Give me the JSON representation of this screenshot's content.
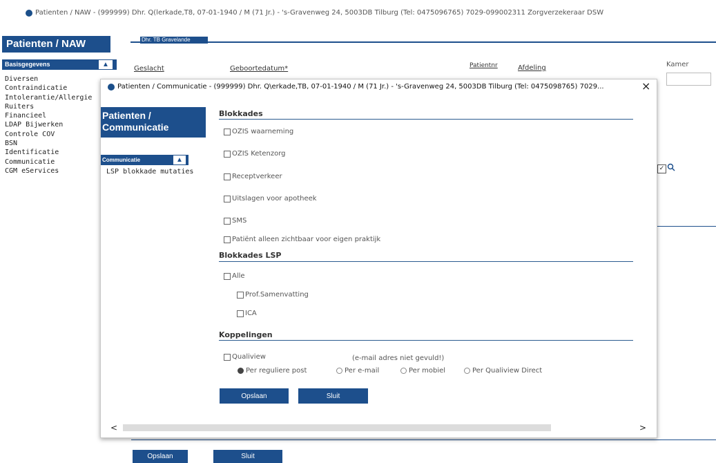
{
  "window": {
    "title": "Patienten / NAW - (999999) Dhr. Q(lerkade,T8, 07-01-1940 / M (71 Jr.) - 's-Gravenweg 24, 5003DB Tilburg (Tel: 0475096765) 7029-099002311 Zorgverzekeraar DSW"
  },
  "background": {
    "heading": "Patienten / NAW",
    "tab": "Dhr. TB Gravelande",
    "sidebar_section": "Basisgegevens",
    "sidebar_items": [
      "Diversen",
      "Contraindicatie",
      "Intolerantie/Allergie",
      "Ruiters",
      "Financieel",
      "LDAP Bijwerken",
      "Controle COV",
      "BSN",
      "Identificatie",
      "Communicatie",
      "CGM eServices"
    ],
    "field_labels": {
      "geslacht": "Geslacht",
      "geboortedatum": "Geboortedatum*",
      "patientnr": "Patientnr",
      "afdeling": "Afdeling",
      "kamer": "Kamer"
    },
    "buttons": {
      "opslaan": "Opslaan",
      "sluit": "Sluit"
    }
  },
  "modal": {
    "title": "Patienten / Communicatie - (999999) Dhr. Q\\erkade,TB, 07-01-1940 / M (71 Jr.) - 's-Gravenweg 24, 5003DB Tilburg (Tel: 0475098765) 7029...",
    "close": "×",
    "side_heading": "Patienten / Communicatie",
    "side_section": "Communicatie",
    "side_items": [
      "LSP blokkade mutaties"
    ],
    "blokkades": {
      "heading": "Blokkades",
      "items": [
        "OZIS waarneming",
        "OZIS Ketenzorg",
        "Receptverkeer",
        "Uitslagen voor apotheek",
        "SMS",
        "Patiënt alleen zichtbaar voor eigen praktijk"
      ]
    },
    "blokkades_lsp": {
      "heading": "Blokkades LSP",
      "all": "Alle",
      "items": [
        "Prof.Samenvatting",
        "ICA"
      ]
    },
    "koppelingen": {
      "heading": "Koppelingen",
      "qualiview": "Qualiview",
      "email_note": "(e-mail adres niet gevuld!)",
      "radios": [
        "Per reguliere post",
        "Per e-mail",
        "Per mobiel",
        "Per Qualiview Direct"
      ],
      "selected": "Per reguliere post"
    },
    "buttons": {
      "opslaan": "Opslaan",
      "sluit": "Sluit"
    },
    "scroll": {
      "left": "<",
      "right": ">"
    }
  },
  "colors": {
    "brand_blue": "#1d4f8c",
    "rule_blue": "#2a5a8f"
  },
  "icons": [
    "app-icon",
    "close-icon",
    "chevron-up-icon",
    "search-icon",
    "scroll-left-icon",
    "scroll-right-icon"
  ]
}
